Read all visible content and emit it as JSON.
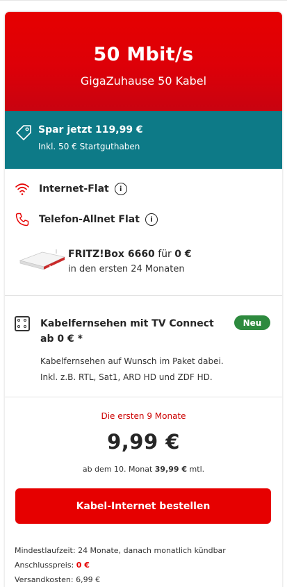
{
  "hero": {
    "speed": "50 Mbit/s",
    "product": "GigaZuhause 50 Kabel"
  },
  "promo": {
    "title": "Spar jetzt 119,99 €",
    "subtitle": "Inkl. 50 € Startguthaben",
    "icon": "price-tag-icon"
  },
  "features": [
    {
      "label": "Internet-Flat",
      "icon": "wifi-icon",
      "info": "i"
    },
    {
      "label": "Telefon-Allnet Flat",
      "icon": "phone-icon",
      "info": "i"
    }
  ],
  "router": {
    "name": "FRITZ!Box 6660",
    "for_text": " für ",
    "price": "0 €",
    "period": "in den ersten 24 Monaten"
  },
  "tv": {
    "title": "Kabelfernsehen mit TV Connect ab 0 € *",
    "badge": "Neu",
    "desc_line1": "Kabelfernsehen auf Wunsch im Paket dabei.",
    "desc_line2": "Inkl. z.B. RTL, Sat1, ARD HD und ZDF HD."
  },
  "pricing": {
    "headline": "Die ersten 9 Monate",
    "price": "9,99 €",
    "after_prefix": "ab dem 10. Monat ",
    "after_price": "39,99 €",
    "after_suffix": " mtl."
  },
  "cta": {
    "label": "Kabel-Internet bestellen"
  },
  "footer": {
    "term": "Mindestlaufzeit: 24 Monate, danach monatlich kündbar",
    "setup_label": "Anschlusspreis: ",
    "setup_value": "0 €",
    "shipping": "Versandkosten: 6,99 €"
  },
  "colors": {
    "brand_red": "#e60000",
    "teal": "#0d7a87",
    "badge_green": "#2d8a3e"
  }
}
